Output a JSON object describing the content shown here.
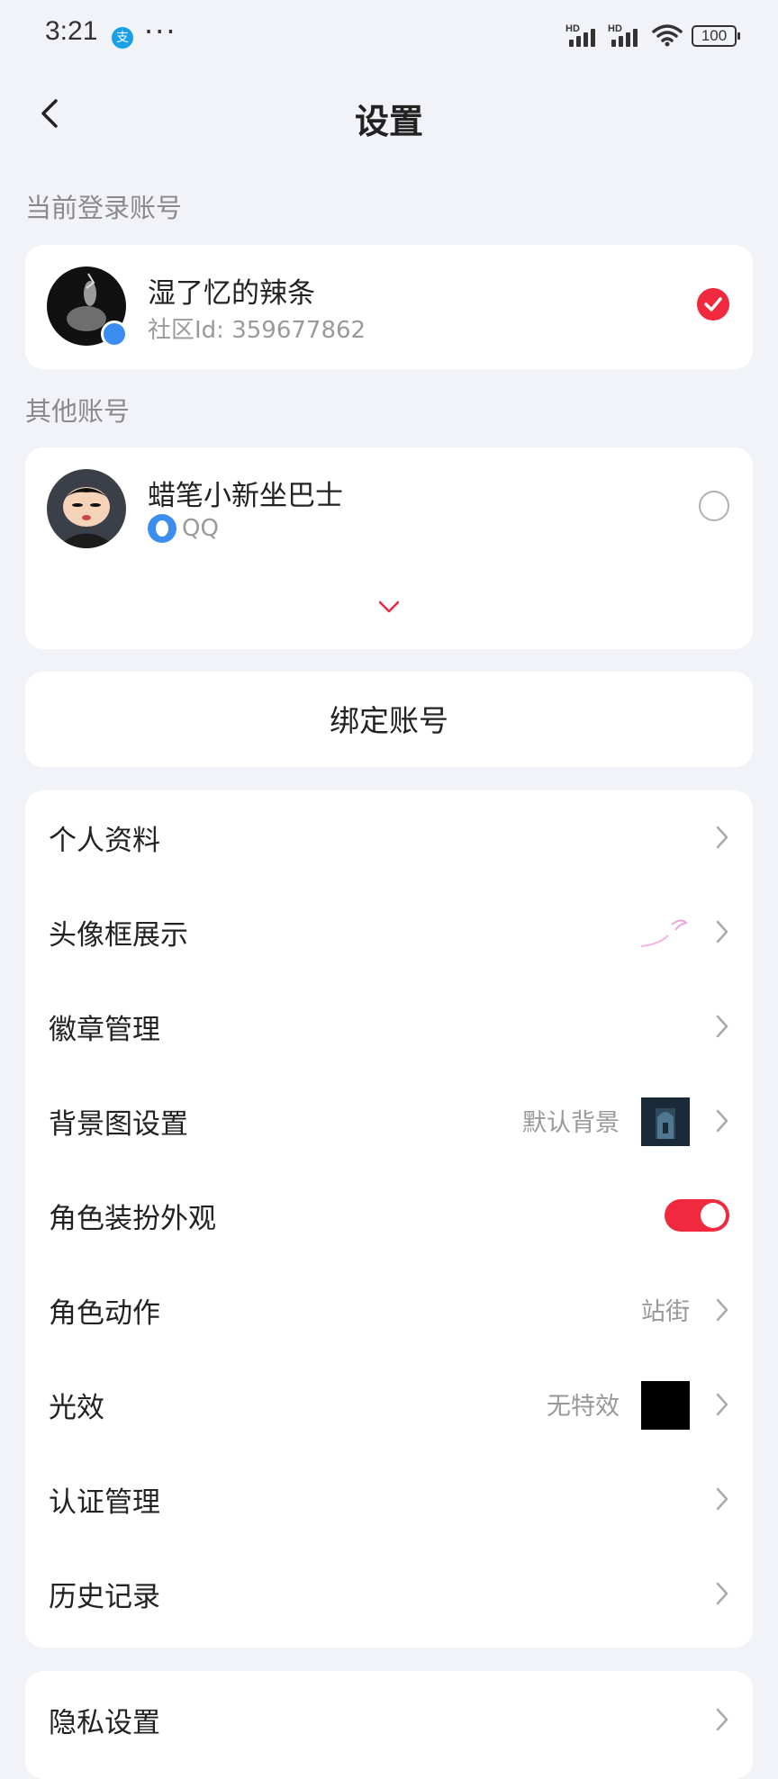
{
  "status_bar": {
    "time": "3:21",
    "app_icon": "支",
    "dots": "···",
    "signal_label": "HD",
    "battery": "100"
  },
  "header": {
    "title": "设置",
    "back_icon": "chevron-left-icon"
  },
  "current_account": {
    "section_label": "当前登录账号",
    "name": "湿了忆的辣条",
    "sub": "社区Id: 359677862",
    "selected": true
  },
  "other_accounts": {
    "section_label": "其他账号",
    "items": [
      {
        "name": "蜡笔小新坐巴士",
        "sub": "QQ",
        "selected": false
      }
    ],
    "expand_icon": "chevron-down-icon"
  },
  "bind_account": {
    "label": "绑定账号"
  },
  "menu": {
    "items": [
      {
        "label": "个人资料"
      },
      {
        "label": "头像框展示"
      },
      {
        "label": "徽章管理"
      },
      {
        "label": "背景图设置",
        "value": "默认背景"
      },
      {
        "label": "角色装扮外观",
        "toggle": true
      },
      {
        "label": "角色动作",
        "value": "站街"
      },
      {
        "label": "光效",
        "value": "无特效"
      },
      {
        "label": "认证管理"
      },
      {
        "label": "历史记录"
      }
    ]
  },
  "privacy": {
    "label": "隐私设置"
  },
  "colors": {
    "accent": "#f0293f",
    "background": "#f1f3f8",
    "card": "#ffffff",
    "qq_blue": "#3b8df0"
  }
}
